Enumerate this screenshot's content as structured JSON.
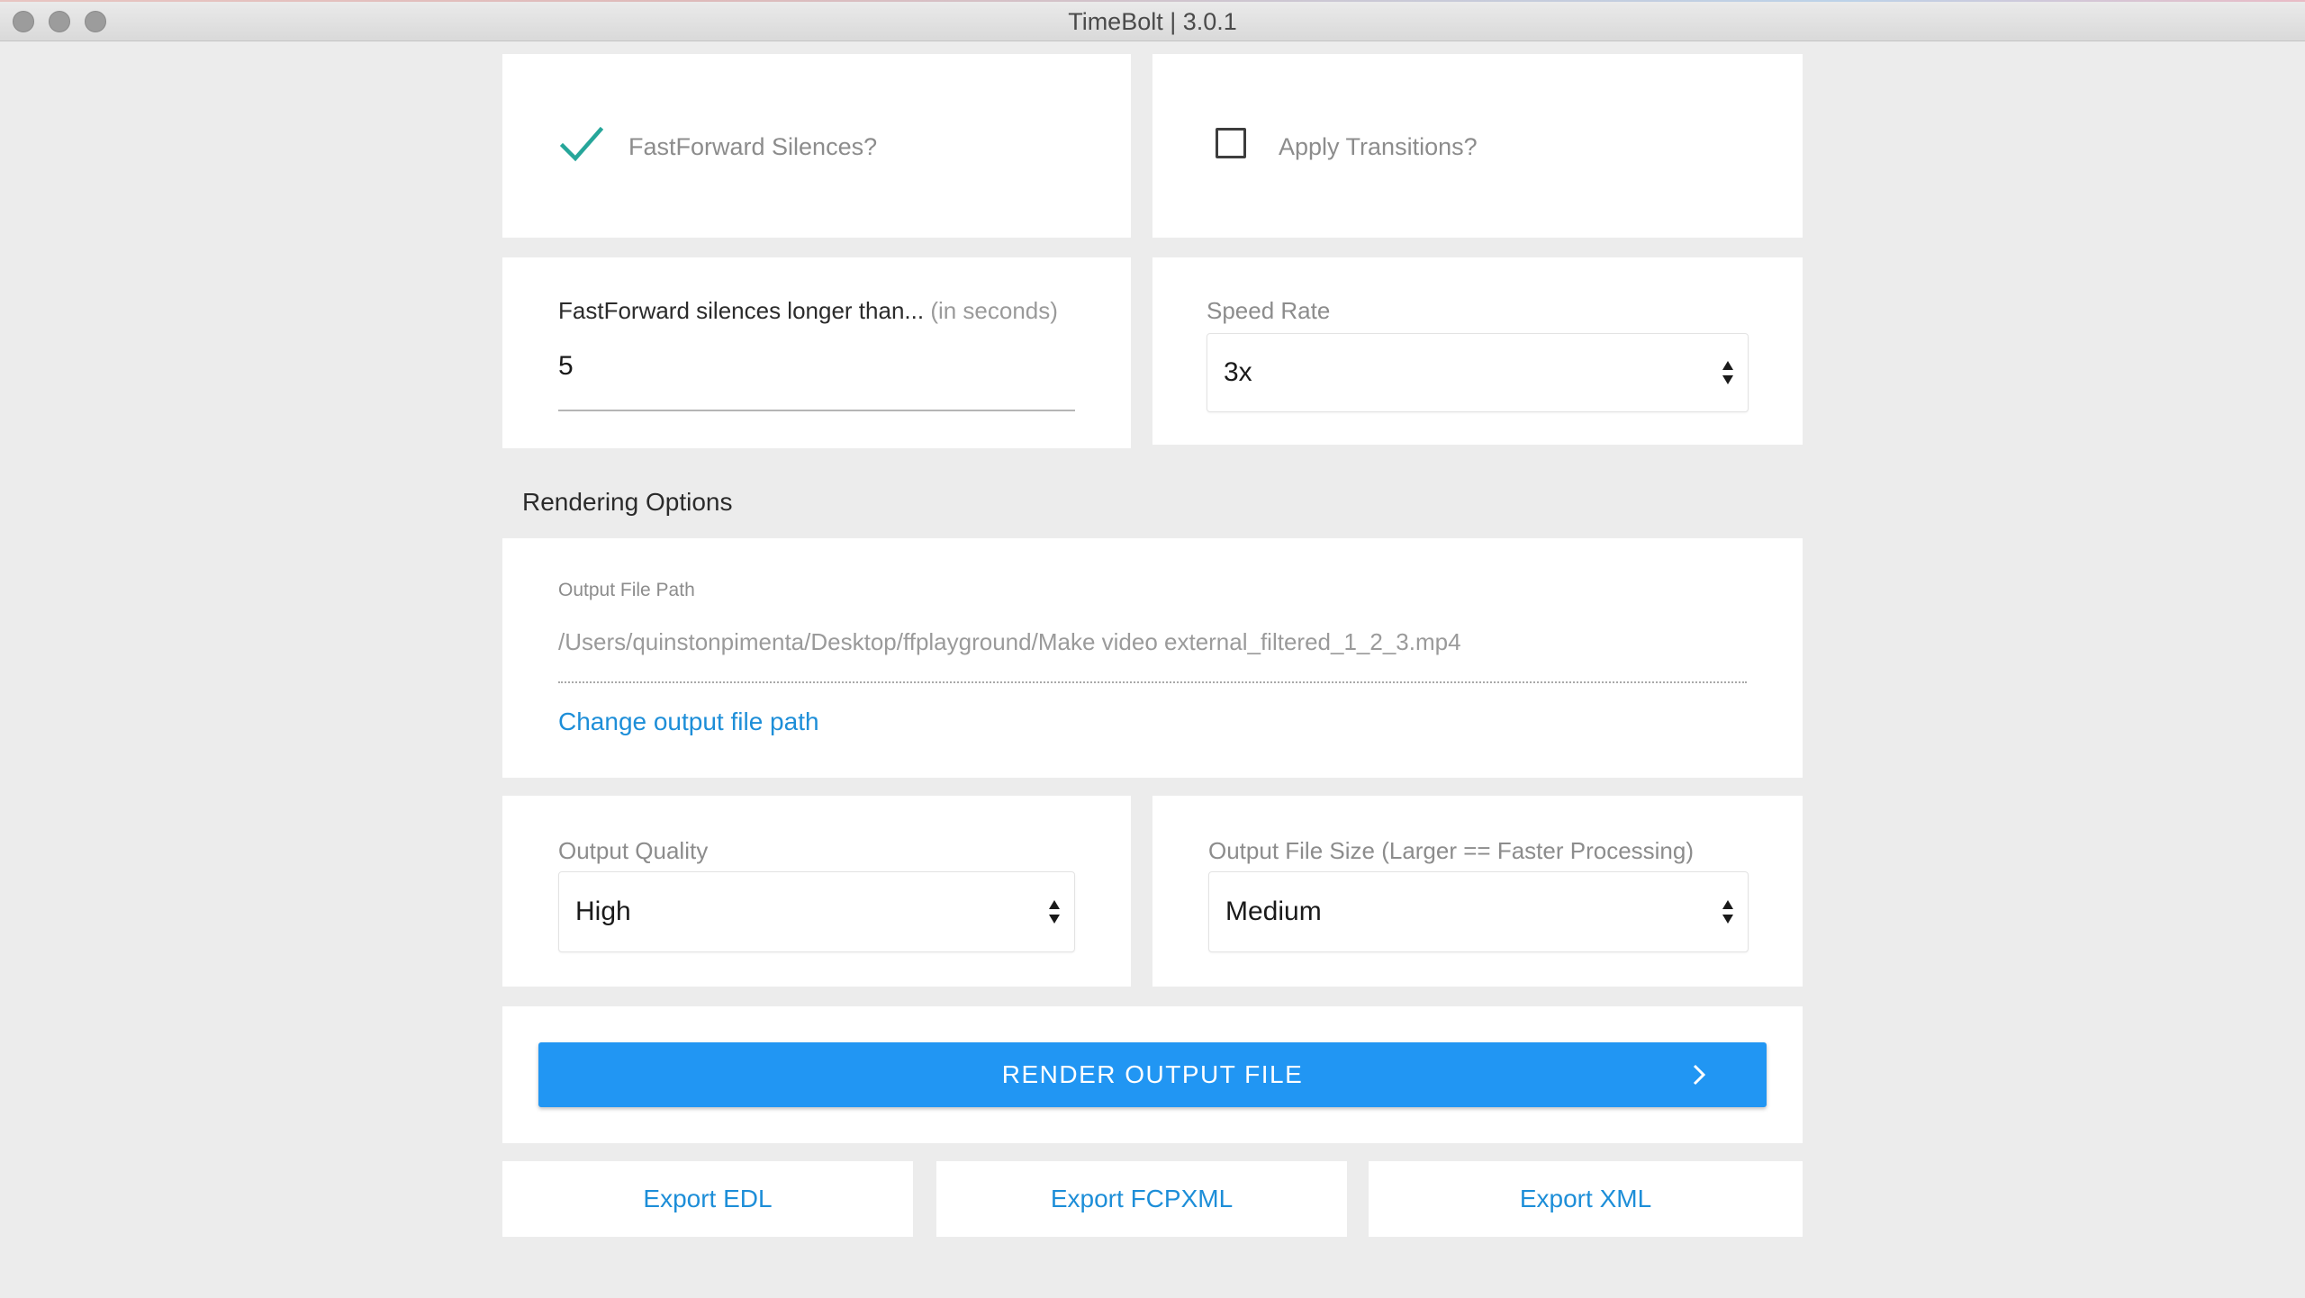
{
  "window": {
    "title": "TimeBolt | 3.0.1"
  },
  "options": {
    "fastforward_silences": {
      "label": "FastForward Silences?",
      "checked": true
    },
    "apply_transitions": {
      "label": "Apply Transitions?",
      "checked": false
    }
  },
  "silence_threshold": {
    "label": "FastForward silences longer than...",
    "hint": "(in seconds)",
    "value": "5"
  },
  "speed_rate": {
    "label": "Speed Rate",
    "selected": "3x"
  },
  "rendering": {
    "heading": "Rendering Options",
    "output_path_label": "Output File Path",
    "output_path_value": "/Users/quinstonpimenta/Desktop/ffplayground/Make video external_filtered_1_2_3.mp4",
    "change_path_link": "Change output file path",
    "quality": {
      "label": "Output Quality",
      "selected": "High"
    },
    "file_size": {
      "label": "Output File Size (Larger == Faster Processing)",
      "selected": "Medium"
    },
    "render_button": "RENDER OUTPUT FILE"
  },
  "exports": {
    "edl": "Export EDL",
    "fcpxml": "Export FCPXML",
    "xml": "Export XML"
  },
  "colors": {
    "accent_teal": "#26a69a",
    "primary_blue": "#2196f3",
    "link_blue": "#1d8ed8"
  }
}
